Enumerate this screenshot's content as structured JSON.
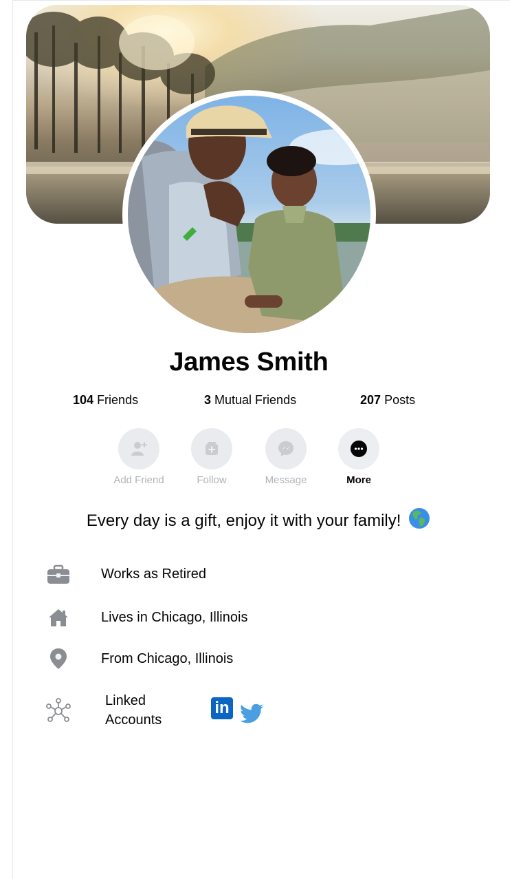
{
  "profile": {
    "name": "James Smith",
    "bio": "Every day is a gift, enjoy it with your family!",
    "bio_emoji": "globe-americas-emoji"
  },
  "stats": {
    "friends_count": "104",
    "friends_label": "Friends",
    "mutual_count": "3",
    "mutual_label": "Mutual Friends",
    "posts_count": "207",
    "posts_label": "Posts"
  },
  "actions": {
    "add_friend": "Add Friend",
    "follow": "Follow",
    "message": "Message",
    "more": "More"
  },
  "about": {
    "work": "Works as Retired",
    "lives": "Lives in Chicago, Illinois",
    "from": "From Chicago, Illinois",
    "linked_accounts": "Linked Accounts"
  },
  "linked": {
    "linkedin_text": "in",
    "linkedin_color": "#0a66c2",
    "twitter_color": "#4a9fe3"
  },
  "icons": [
    "add-friend-icon",
    "follow-icon",
    "messenger-icon",
    "more-icon",
    "briefcase-icon",
    "home-icon",
    "location-pin-icon",
    "network-icon",
    "linkedin-icon",
    "twitter-icon"
  ],
  "colors": {
    "text": "#050505",
    "muted": "#b0b3b8",
    "icon_gray": "#8a8d91",
    "button_bg": "#e9ebee"
  }
}
